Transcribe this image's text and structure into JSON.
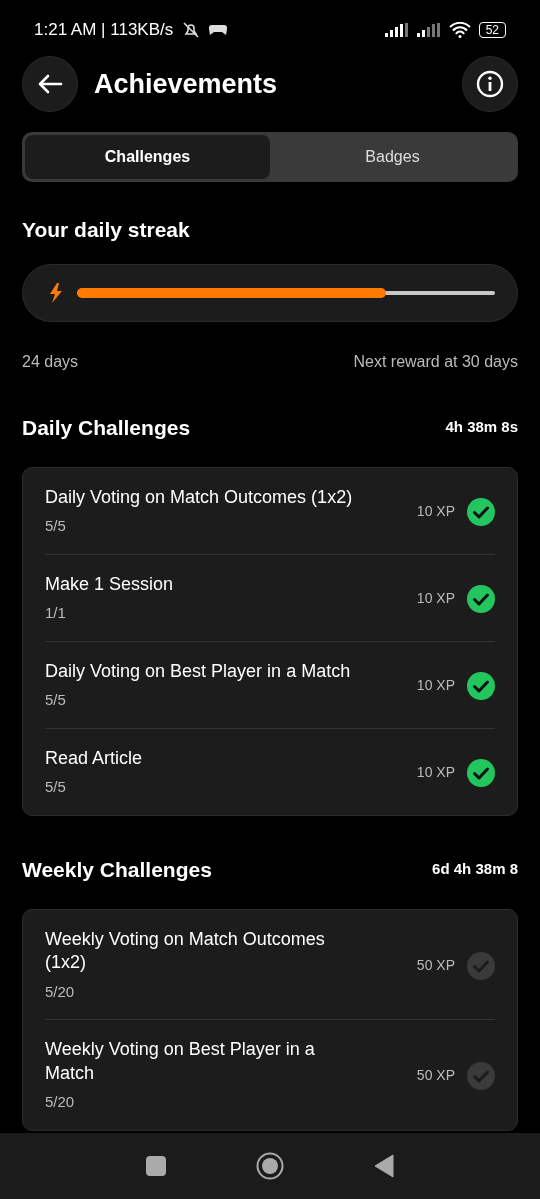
{
  "status_bar": {
    "time": "1:21 AM | 113KB/s",
    "battery": "52"
  },
  "header": {
    "title": "Achievements"
  },
  "tabs": [
    {
      "label": "Challenges",
      "selected": true
    },
    {
      "label": "Badges",
      "selected": false
    }
  ],
  "streak": {
    "title": "Your daily streak",
    "level": 0.74,
    "days": "24 days",
    "next_reward": "Next reward at 30 days"
  },
  "sections": [
    {
      "title": "Daily Challenges",
      "timer": "4h 38m 8s",
      "challenges": [
        {
          "name": "Daily Voting on Match Outcomes (1x2)",
          "progress": "5/5",
          "xp": "10 XP",
          "completed": true
        },
        {
          "name": "Make 1 Session",
          "progress": "1/1",
          "xp": "10 XP",
          "completed": true
        },
        {
          "name": "Daily Voting on Best Player in a Match",
          "progress": "5/5",
          "xp": "10 XP",
          "completed": true
        },
        {
          "name": "Read Article",
          "progress": "5/5",
          "xp": "10 XP",
          "completed": true
        }
      ]
    },
    {
      "title": "Weekly Challenges",
      "timer": "6d 4h 38m 8",
      "challenges": [
        {
          "name": "Weekly Voting on Match Outcomes (1x2)",
          "progress": "5/20",
          "xp": "50 XP",
          "completed": false
        },
        {
          "name": "Weekly Voting on Best Player in a Match",
          "progress": "5/20",
          "xp": "50 XP",
          "completed": false
        }
      ]
    }
  ]
}
